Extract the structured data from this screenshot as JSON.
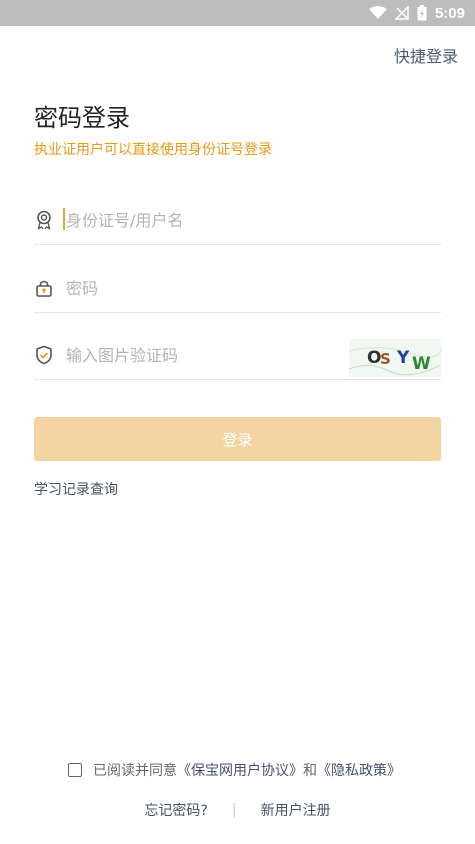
{
  "status_bar": {
    "time": "5:09"
  },
  "header": {
    "quick_login": "快捷登录"
  },
  "title": "密码登录",
  "subtitle": "执业证用户可以直接使用身份证号登录",
  "form": {
    "username_placeholder": "身份证号/用户名",
    "password_placeholder": "密码",
    "captcha_placeholder": "输入图片验证码",
    "captcha_text": "OSYW",
    "login_label": "登录"
  },
  "study_link": "学习记录查询",
  "agreement": {
    "prefix": "已阅读并同意",
    "user_agreement": "《保宝网用户协议》",
    "and": "和",
    "privacy_policy": "《隐私政策》"
  },
  "bottom": {
    "forgot_password": "忘记密码?",
    "separator": "|",
    "register": "新用户注册"
  },
  "colors": {
    "accent": "#e29b16",
    "button_disabled": "#f3d4a2",
    "link": "#46526a"
  }
}
